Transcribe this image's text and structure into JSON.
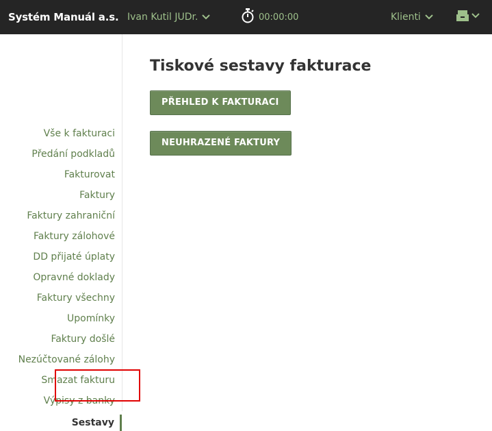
{
  "header": {
    "brand": "Systém Manuál a.s.",
    "user": "Ivan Kutil JUDr.",
    "timer": "00:00:00",
    "clients": "Klienti"
  },
  "sidebar": {
    "items": [
      {
        "label": "Vše k fakturaci"
      },
      {
        "label": "Předání podkladů"
      },
      {
        "label": "Fakturovat"
      },
      {
        "label": "Faktury"
      },
      {
        "label": "Faktury zahraniční"
      },
      {
        "label": "Faktury zálohové"
      },
      {
        "label": "DD přijaté úplaty"
      },
      {
        "label": "Opravné doklady"
      },
      {
        "label": "Faktury všechny"
      },
      {
        "label": "Upomínky"
      },
      {
        "label": "Faktury došlé"
      },
      {
        "label": "Nezúčtované zálohy"
      },
      {
        "label": "Smazat fakturu"
      },
      {
        "label": "Výpisy z banky"
      },
      {
        "label": "Sestavy",
        "active": true
      }
    ]
  },
  "main": {
    "title": "Tiskové sestavy fakturace",
    "buttons": [
      {
        "label": "PŘEHLED K FAKTURACI"
      },
      {
        "label": "NEUHRAZENÉ FAKTURY"
      }
    ]
  },
  "colors": {
    "topbar": "#252525",
    "accent": "#5f7f4c",
    "button": "#6d8a5a",
    "highlight": "#e00000"
  },
  "icons": [
    "chevron-down-icon",
    "stopwatch-icon",
    "archive-box-icon"
  ]
}
